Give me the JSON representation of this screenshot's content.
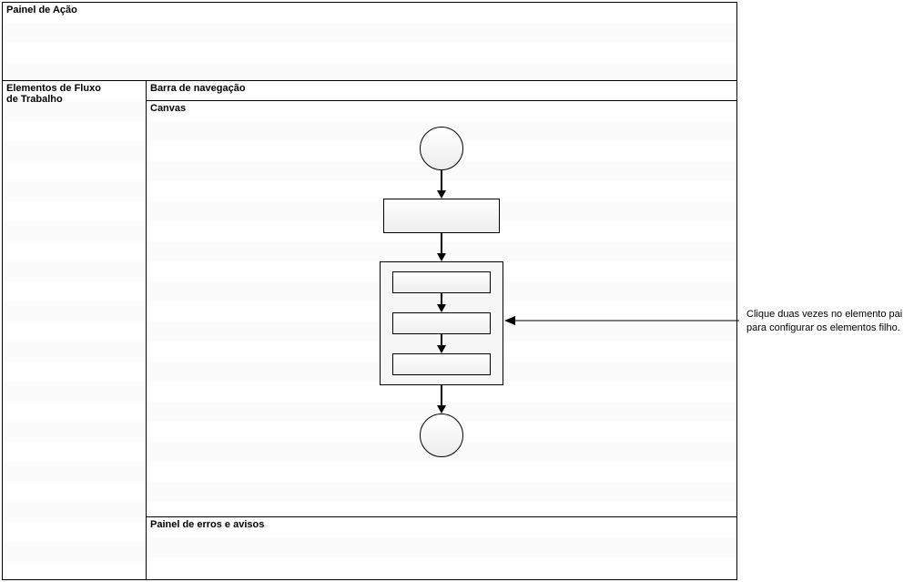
{
  "panels": {
    "action": "Painel de Ação",
    "workflow_elements_line1": "Elementos de Fluxo",
    "workflow_elements_line2": "de Trabalho",
    "navigation_bar": "Barra de navegação",
    "canvas": "Canvas",
    "errors": "Painel de erros e avisos"
  },
  "flow": {
    "start_node": "start",
    "task_node": "task",
    "parent_node": "parent-container",
    "child_nodes": [
      "child-1",
      "child-2",
      "child-3"
    ],
    "end_node": "end"
  },
  "callout": {
    "line1": "Clique duas vezes no elemento pai",
    "line2": "para configurar os elementos filho."
  }
}
